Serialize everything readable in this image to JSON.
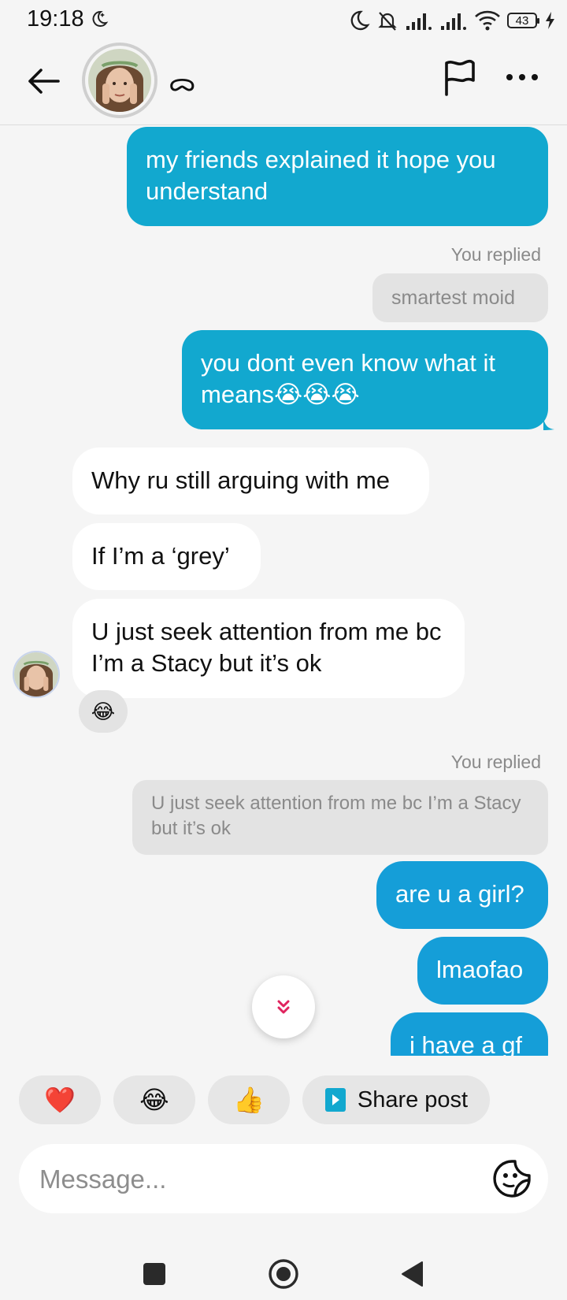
{
  "status_bar": {
    "time": "19:18",
    "battery": "43"
  },
  "header": {
    "username": "ᯅ"
  },
  "messages": {
    "sent_1": "my friends explained it hope you understand",
    "replied_label_1": "You replied",
    "quote_1": "smartest moid",
    "sent_2": "you dont even know what it means😭😭😭",
    "recv_1": "Why ru still arguing with me",
    "recv_2": "If I’m a ‘grey’",
    "recv_3": "U just seek attention  from me bc I’m a Stacy but it’s ok",
    "reaction_recv_3": "😂",
    "replied_label_2": "You replied",
    "quote_2": "U just seek attention  from me bc I’m a Stacy but it’s ok",
    "sent_3": "are u a girl?",
    "sent_4": "lmaofao",
    "sent_5": "i have a gf"
  },
  "quick_reactions": {
    "heart": "❤️",
    "laugh": "😂",
    "thumbs": "👍",
    "share_post": "Share post"
  },
  "composer": {
    "placeholder": "Message..."
  },
  "icons": {
    "back": "back-arrow-icon",
    "flag": "flag-icon",
    "more": "more-icon",
    "sticker": "sticker-icon",
    "scroll_down": "double-chevron-down-icon"
  },
  "colors": {
    "sent_bubble": "#12a8cf",
    "sent_bubble_later": "#159ed8",
    "received_bubble": "#ffffff",
    "quote_bubble": "#e3e3e3",
    "background": "#f5f5f5",
    "scroll_chevron": "#e0245e"
  }
}
